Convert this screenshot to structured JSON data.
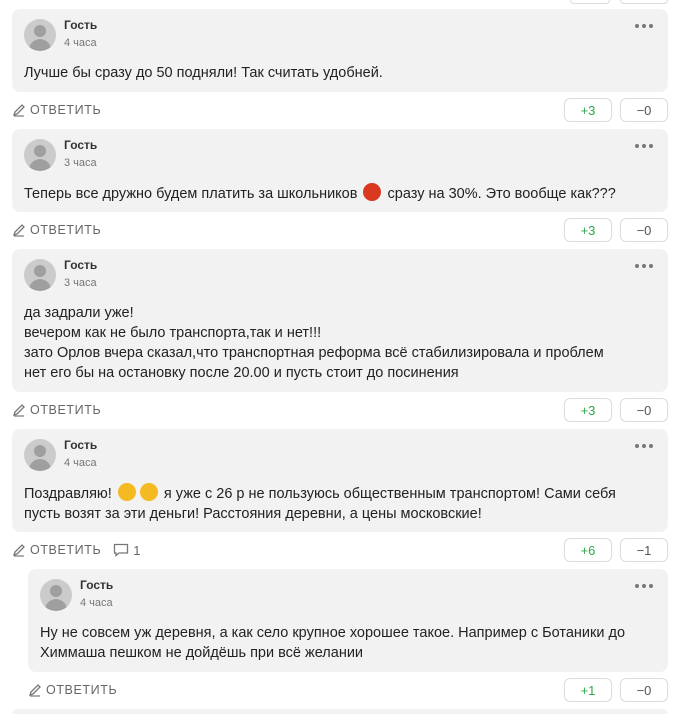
{
  "reply_label": "ОТВЕТИТЬ",
  "colors": {
    "card_bg": "#f2f2f2",
    "upvote": "#2ea84a",
    "text": "#222222",
    "meta": "#777777"
  },
  "comments": [
    {
      "author": "Гость",
      "time": "4 часа",
      "lines": [
        "Лучше бы сразу до 50 подняли! Так считать удобней."
      ],
      "up": "+3",
      "down": "−0"
    },
    {
      "author": "Гость",
      "time": "3 часа",
      "text_before_emoji": "Теперь все дружно будем платить за школьников",
      "emoji": "angry-face-emoji",
      "text_after_emoji": "сразу на 30%. Это вообще как???",
      "up": "+3",
      "down": "−0"
    },
    {
      "author": "Гость",
      "time": "3 часа",
      "lines": [
        "да задрали уже!",
        "вечером как не было транспорта,так и нет!!!",
        "зато Орлов вчера сказал,что транспортная реформа всё стабилизировала и проблем",
        "нет его бы на остановку после 20.00 и пусть стоит до посинения"
      ],
      "up": "+3",
      "down": "−0"
    },
    {
      "author": "Гость",
      "time": "4 часа",
      "text_before_emoji": "Поздравляю!",
      "emoji": "laughing-face-emoji",
      "text_after_emoji": "я уже с 26 р не пользуюсь общественным транспортом! Сами себя",
      "line2": "пусть возят за эти деньги! Расстояния деревни, а цены московские!",
      "replies_count": "1",
      "up": "+6",
      "down": "−1"
    },
    {
      "author": "Гость",
      "time": "4 часа",
      "lines": [
        "Ну не совсем уж деревня, а как село крупное хорошее такое. Например с Ботаники до",
        "Химмаша пешком не дойдёшь при всё желании"
      ],
      "up": "+1",
      "down": "−0"
    }
  ]
}
